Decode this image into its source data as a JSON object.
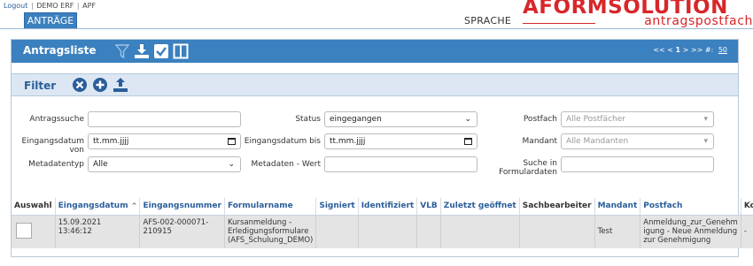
{
  "top_links": {
    "logout": "Logout",
    "separator": "|",
    "user": "DEMO ERF",
    "org": "APF"
  },
  "tabs": [
    {
      "label": "ANTRÄGE"
    }
  ],
  "sprache": "SPRACHE",
  "logo": {
    "main": "AFORMSOLUTION",
    "sub": "antragspostfach"
  },
  "list": {
    "title": "Antragsliste",
    "toolbar_icons": [
      "filter-icon",
      "download-icon",
      "checkbox-checked-icon",
      "columns-icon"
    ],
    "pager": {
      "prev": "<< <",
      "current": "1",
      "next": "> >>",
      "hash": "#:",
      "per_page": "50"
    }
  },
  "filter": {
    "title": "Filter",
    "icons": [
      "clear-icon",
      "add-icon",
      "upload-icon"
    ],
    "fields": {
      "antragssuche": {
        "label": "Antragssuche",
        "value": ""
      },
      "eingangsdatum_von": {
        "label": "Eingangsdatum von",
        "value": "tt.mm.jjjj"
      },
      "metadatentyp": {
        "label": "Metadatentyp",
        "value": "Alle"
      },
      "status": {
        "label": "Status",
        "value": "eingegangen"
      },
      "eingangsdatum_bis": {
        "label": "Eingangsdatum bis",
        "value": "tt.mm.jjjj"
      },
      "metadaten_wert": {
        "label": "Metadaten - Wert",
        "value": ""
      },
      "postfach": {
        "label": "Postfach",
        "value": "Alle Postfächer"
      },
      "mandant": {
        "label": "Mandant",
        "value": "Alle Mandanten"
      },
      "suche_formulardaten": {
        "label_line1": "Suche in",
        "label_line2": "Formulardaten",
        "value": ""
      }
    }
  },
  "table": {
    "columns": [
      "Auswahl",
      "Eingangsdatum",
      "Eingangsnummer",
      "Formularname",
      "Signiert",
      "Identifiziert",
      "VLB",
      "Zuletzt geöffnet",
      "Sachbearbeiter",
      "Mandant",
      "Postfach",
      "Komm"
    ],
    "sort_indicator": "^",
    "rows": [
      {
        "eingangsdatum_1": "15.09.2021",
        "eingangsdatum_2": "13:46:12",
        "eingangsnummer_1": "AFS-002-000071-",
        "eingangsnummer_2": "210915",
        "formularname_1": "Kursanmeldung -",
        "formularname_2": "Erledigungsformulare",
        "formularname_3": "(AFS_Schulung_DEMO)",
        "signiert": "",
        "identifiziert": "",
        "vlb": "",
        "zuletzt_geoeffnet": "",
        "sachbearbeiter": "",
        "mandant": "Test",
        "postfach_1": "Anmeldung_zur_Genehm",
        "postfach_2": "igung - Neue Anmeldung",
        "postfach_3": "zur Genehmigung",
        "komm": "-"
      }
    ]
  },
  "colors": {
    "header_blue": "#3b80bf",
    "link_blue": "#2a5e9a",
    "logo_red": "#d8262a",
    "filter_bg": "#dce7f3"
  }
}
